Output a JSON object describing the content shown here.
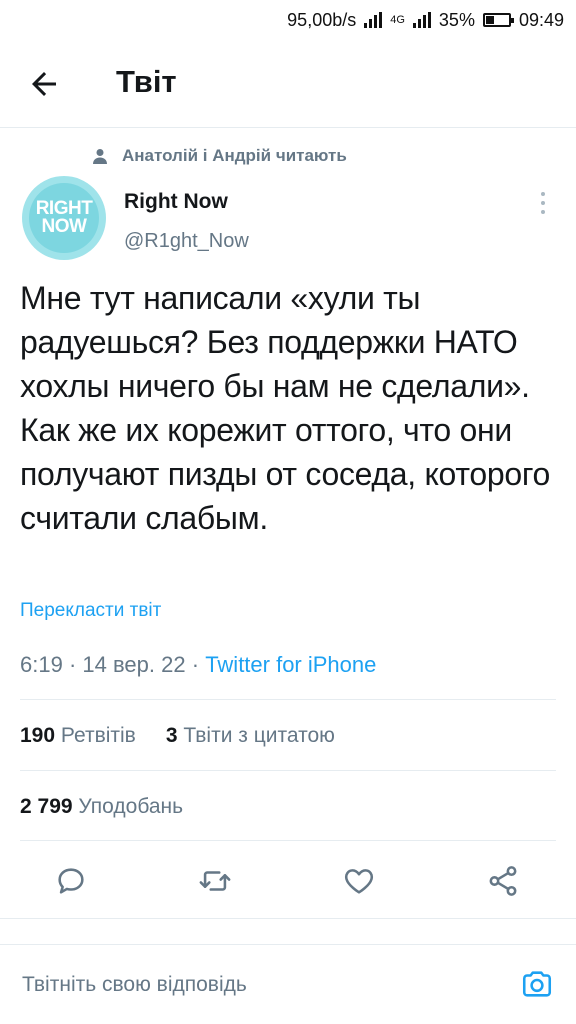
{
  "status_bar": {
    "net_speed": "95,00b/s",
    "network": "4G",
    "battery": "35%",
    "time": "09:49"
  },
  "header": {
    "title": "Твіт"
  },
  "social_context": {
    "text": "Анатолій і Андрій читають"
  },
  "author": {
    "name": "Right Now",
    "handle": "@R1ght_Now",
    "avatar_line1": "RIGHT",
    "avatar_line2": "NOW"
  },
  "tweet": {
    "text": "Мне тут написали «хули ты радуешься? Без поддержки НАТО хохлы ничего бы нам не сделали». Как же их корежит оттого, что они получают пизды от соседа, которого считали слабым.",
    "translate_label": "Перекласти твіт",
    "time": "6:19",
    "date": "14 вер. 22",
    "source": "Twitter for iPhone"
  },
  "stats": {
    "retweets_count": "190",
    "retweets_label": "Ретвітів",
    "quotes_count": "3",
    "quotes_label": "Твіти з цитатою",
    "likes_count": "2 799",
    "likes_label": "Уподобань"
  },
  "reply": {
    "placeholder": "Твітніть свою відповідь"
  },
  "colors": {
    "accent": "#1da1f2",
    "secondary_text": "#657786",
    "divider": "#e6ecf0"
  }
}
